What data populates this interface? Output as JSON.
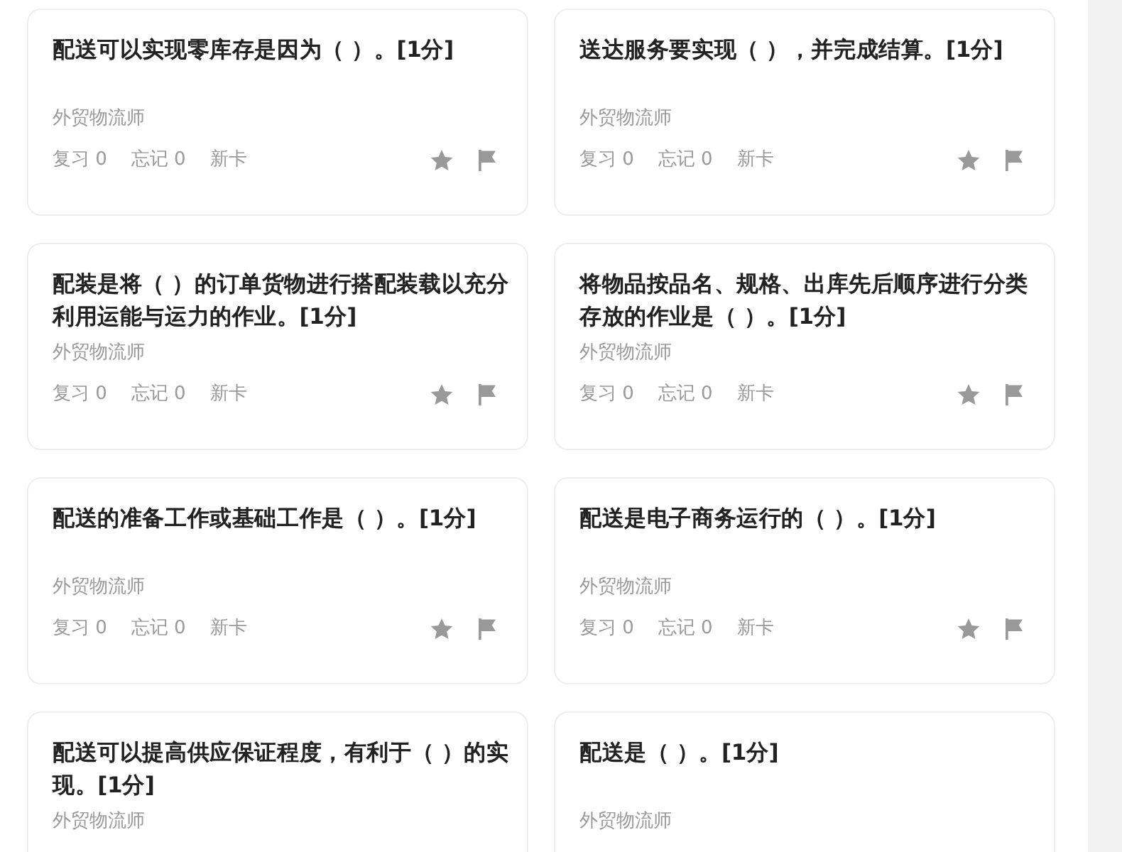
{
  "cards": [
    {
      "title": "配送可以实现零库存是因为（ ）。[1分]",
      "source": "外贸物流师",
      "review": "复习 0",
      "forget": "忘记 0",
      "status": "新卡"
    },
    {
      "title": "送达服务要实现（ ），并完成结算。[1分]",
      "source": "外贸物流师",
      "review": "复习 0",
      "forget": "忘记 0",
      "status": "新卡"
    },
    {
      "title": "配装是将（ ）的订单货物进行搭配装载以充分利用运能与运力的作业。[1分]",
      "source": "外贸物流师",
      "review": "复习 0",
      "forget": "忘记 0",
      "status": "新卡"
    },
    {
      "title": "将物品按品名、规格、出库先后顺序进行分类存放的作业是（ ）。[1分]",
      "source": "外贸物流师",
      "review": "复习 0",
      "forget": "忘记 0",
      "status": "新卡"
    },
    {
      "title": "配送的准备工作或基础工作是（ ）。[1分]",
      "source": "外贸物流师",
      "review": "复习 0",
      "forget": "忘记 0",
      "status": "新卡"
    },
    {
      "title": "配送是电子商务运行的（ ）。[1分]",
      "source": "外贸物流师",
      "review": "复习 0",
      "forget": "忘记 0",
      "status": "新卡"
    },
    {
      "title": "配送可以提高供应保证程度，有利于（ ）的实现。[1分]",
      "source": "外贸物流师"
    },
    {
      "title": "配送是（ ）。[1分]",
      "source": "外贸物流师"
    }
  ]
}
